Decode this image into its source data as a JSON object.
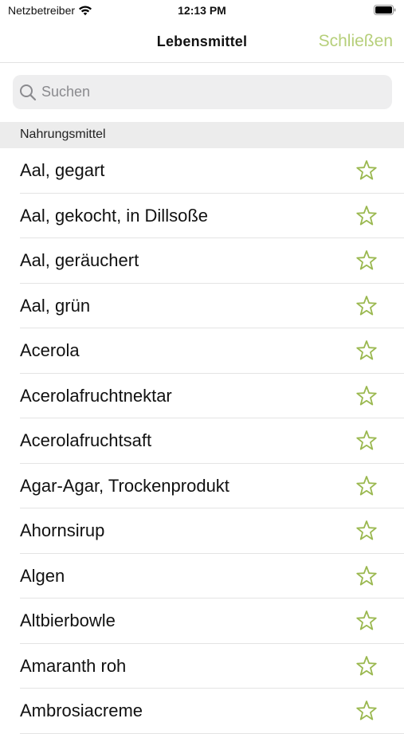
{
  "status_bar": {
    "carrier": "Netzbetreiber",
    "time": "12:13 PM"
  },
  "nav": {
    "title": "Lebensmittel",
    "close_label": "Schließen"
  },
  "search": {
    "placeholder": "Suchen",
    "value": ""
  },
  "section": {
    "title": "Nahrungsmittel"
  },
  "colors": {
    "accent": "#b6cf7a",
    "star": "#9ab84f"
  },
  "items": [
    {
      "label": "Aal, gegart"
    },
    {
      "label": "Aal, gekocht, in Dillsoße"
    },
    {
      "label": "Aal, geräuchert"
    },
    {
      "label": "Aal, grün"
    },
    {
      "label": "Acerola"
    },
    {
      "label": "Acerolafruchtnektar"
    },
    {
      "label": "Acerolafruchtsaft"
    },
    {
      "label": "Agar-Agar, Trockenprodukt"
    },
    {
      "label": "Ahornsirup"
    },
    {
      "label": "Algen"
    },
    {
      "label": "Altbierbowle"
    },
    {
      "label": "Amaranth roh"
    },
    {
      "label": "Ambrosiacreme"
    }
  ]
}
